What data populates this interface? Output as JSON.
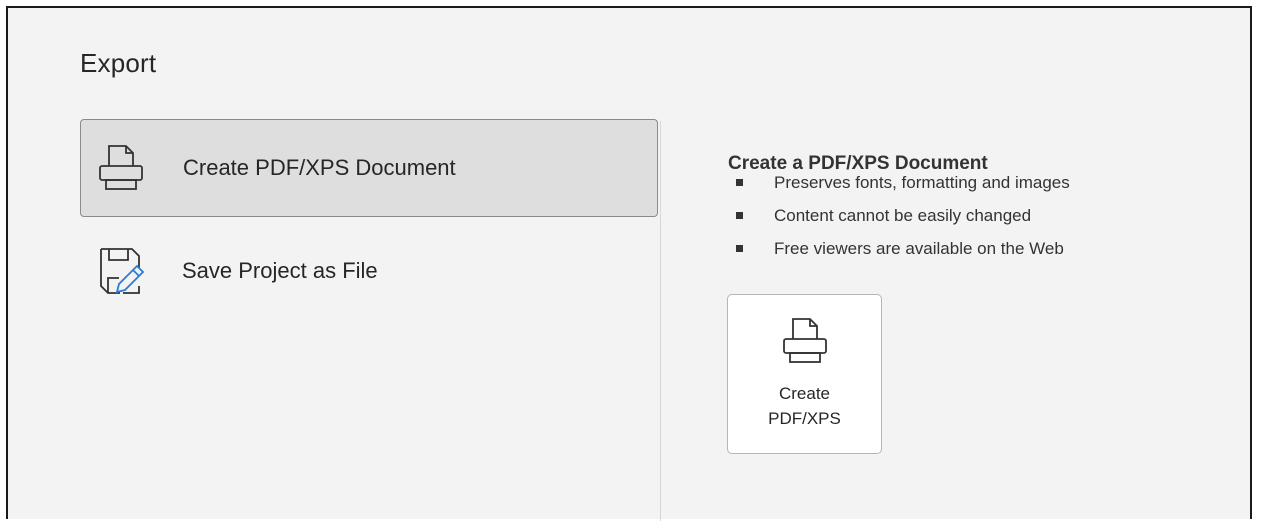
{
  "page": {
    "title": "Export"
  },
  "options": [
    {
      "label": "Create PDF/XPS Document",
      "icon": "printer-icon",
      "selected": true
    },
    {
      "label": "Save Project as File",
      "icon": "save-file-edit-icon",
      "selected": false
    }
  ],
  "detail": {
    "title": "Create a PDF/XPS Document",
    "bullets": [
      "Preserves fonts, formatting and images",
      "Content cannot be easily changed",
      "Free viewers are available on the Web"
    ],
    "button": {
      "line1": "Create",
      "line2": "PDF/XPS",
      "icon": "printer-icon"
    }
  },
  "colors": {
    "panel_bg": "#f3f3f3",
    "selected_bg": "#dedede",
    "selected_border": "#8a8a8a",
    "text": "#262626",
    "pen_accent": "#2b7cd3"
  }
}
